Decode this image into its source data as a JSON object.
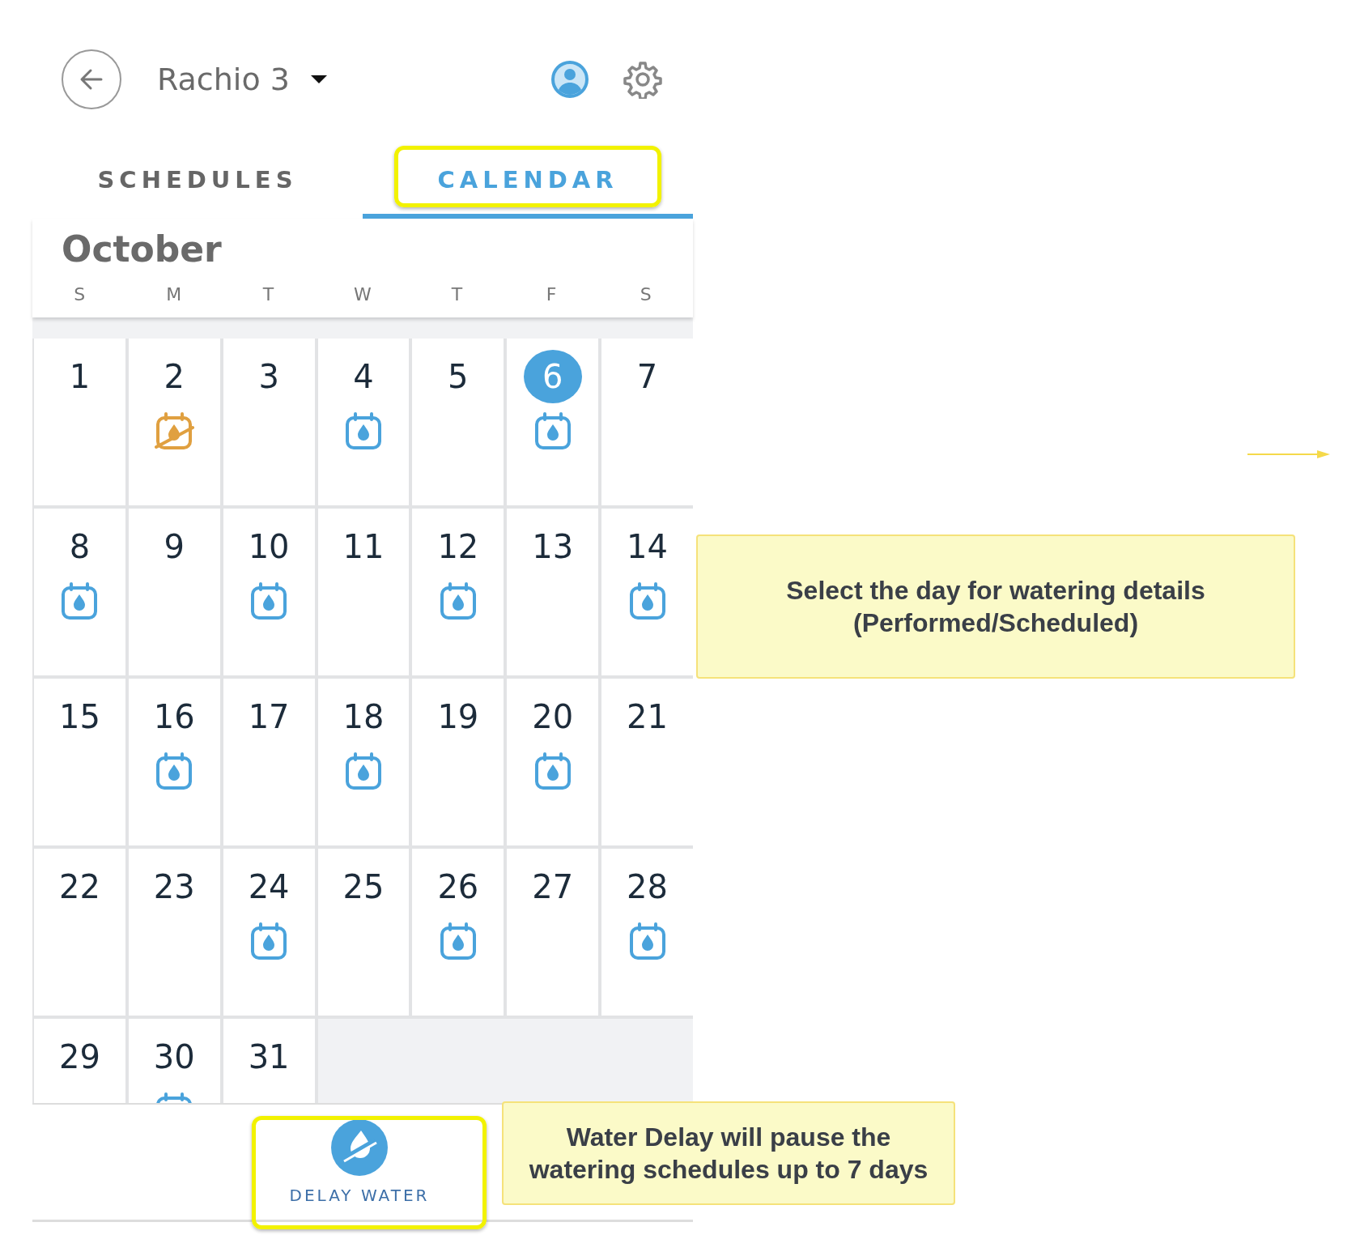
{
  "header": {
    "title": "Rachio 3"
  },
  "tabs": [
    {
      "label": "SCHEDULES",
      "selected": false
    },
    {
      "label": "CALENDAR",
      "selected": true
    }
  ],
  "calendar": {
    "month": "October",
    "weekdays": [
      "S",
      "M",
      "T",
      "W",
      "T",
      "F",
      "S"
    ],
    "days": [
      {
        "label": "1",
        "selected": false
      },
      {
        "label": "2",
        "selected": false,
        "kind": "skipped"
      },
      {
        "label": "3",
        "selected": false
      },
      {
        "label": "4",
        "selected": false,
        "kind": "scheduled"
      },
      {
        "label": "5",
        "selected": false
      },
      {
        "label": "6",
        "selected": true,
        "kind": "scheduled"
      },
      {
        "label": "7",
        "selected": false
      },
      {
        "label": "8",
        "selected": false,
        "kind": "scheduled"
      },
      {
        "label": "9",
        "selected": false
      },
      {
        "label": "10",
        "selected": false,
        "kind": "scheduled"
      },
      {
        "label": "11",
        "selected": false
      },
      {
        "label": "12",
        "selected": false,
        "kind": "scheduled"
      },
      {
        "label": "13",
        "selected": false
      },
      {
        "label": "14",
        "selected": false,
        "kind": "scheduled"
      },
      {
        "label": "15",
        "selected": false
      },
      {
        "label": "16",
        "selected": false,
        "kind": "scheduled"
      },
      {
        "label": "17",
        "selected": false
      },
      {
        "label": "18",
        "selected": false,
        "kind": "scheduled"
      },
      {
        "label": "19",
        "selected": false
      },
      {
        "label": "20",
        "selected": false,
        "kind": "scheduled"
      },
      {
        "label": "21",
        "selected": false
      },
      {
        "label": "22",
        "selected": false
      },
      {
        "label": "23",
        "selected": false
      },
      {
        "label": "24",
        "selected": false,
        "kind": "scheduled"
      },
      {
        "label": "25",
        "selected": false
      },
      {
        "label": "26",
        "selected": false,
        "kind": "scheduled"
      },
      {
        "label": "27",
        "selected": false
      },
      {
        "label": "28",
        "selected": false,
        "kind": "scheduled"
      },
      {
        "label": "29",
        "selected": false
      },
      {
        "label": "30",
        "selected": false,
        "kind": "scheduled"
      },
      {
        "label": "31",
        "selected": false
      }
    ]
  },
  "delay_button": {
    "label": "DELAY WATER"
  },
  "annotations": [
    {
      "text": "Select the day for watering details (Performed/Scheduled)"
    },
    {
      "text": "Water Delay will pause the watering schedules up to 7 days"
    }
  ]
}
